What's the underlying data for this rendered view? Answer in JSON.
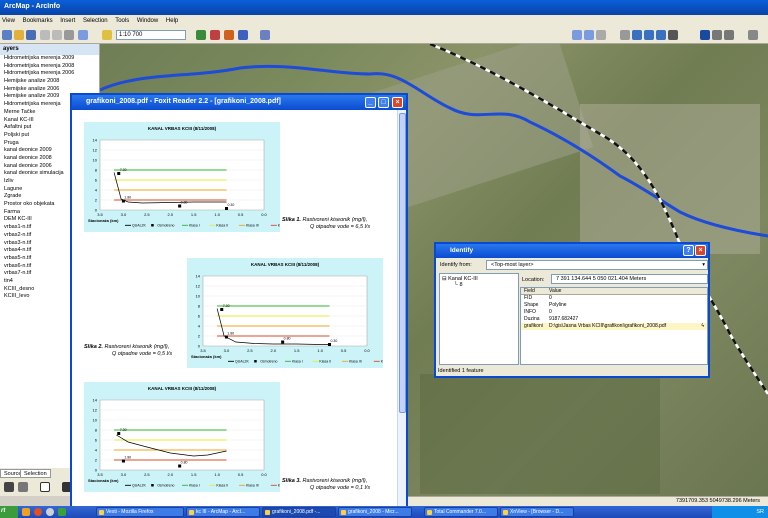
{
  "arcmap": {
    "title": "ArcMap - ArcInfo",
    "menu": [
      "View",
      "Bookmarks",
      "Insert",
      "Selection",
      "Tools",
      "Window",
      "Help"
    ],
    "scale": "1:10 700"
  },
  "toc": {
    "header": "ayers",
    "layers": [
      "Hidrometrijska merenja 2009",
      "Hidrometrijska merenja 2008",
      "Hidrometrijska merenja 2006",
      "Hemijske analize 2008",
      "Hemijske analize 2006",
      "Hemijske analize 2009",
      "Hidrometrijska merenja",
      "Merne Tačke",
      "Kanal KC-III",
      "Asfaltni put",
      "Poljski put",
      "Pruga",
      "kanal deonice 2009",
      "kanal deonice 2008",
      "kanal deonice 2006",
      "kanal deonice simulacija",
      "Izliv",
      "Lagune",
      "Zgrade",
      "Prostor oko objekata",
      "Farma",
      "DEM KC-III",
      "vrbas1-n.tif",
      "vrbas2-n.tif",
      "vrbas3-n.tif",
      "vrbas4-n.tif",
      "vrbas5-n.tif",
      "vrbas6-n.tif",
      "vrbas7-n.tif",
      "tin4",
      "KCIII_desno",
      "KCIII_levo"
    ],
    "tabs": [
      "Source",
      "Selection"
    ]
  },
  "foxit": {
    "title": "grafikoni_2008.pdf - Foxit Reader 2.2 - [grafikoni_2008.pdf]",
    "captions": [
      {
        "label": "Slika 1.",
        "text": "Rastvoreni kiseonik (mg/l),",
        "sub": "Q otpadne vode = 6,5 l/s"
      },
      {
        "label": "Slika 2.",
        "text": "Rastvoreni kiseonik (mg/l),",
        "sub": "Q otpadne vode = 0,5 l/s"
      },
      {
        "label": "Slika 3.",
        "text": "Rastvoreni kiseonik (mg/l),",
        "sub": "Q otpadne vode = 0,1 l/s"
      }
    ]
  },
  "identify": {
    "title": "Identify",
    "from_label": "Identify from:",
    "from_value": "<Top-most layer>",
    "tree_layer": "Kanal KC-III",
    "tree_child": "8",
    "location_label": "Location:",
    "location_value": "7 391 134.644  5 050 021.404 Meters",
    "columns": [
      "Field",
      "Value"
    ],
    "rows": [
      {
        "field": "FID",
        "value": "0"
      },
      {
        "field": "Shape",
        "value": "Polyline"
      },
      {
        "field": "INFO",
        "value": "0"
      },
      {
        "field": "Duzina",
        "value": "9187.682427"
      },
      {
        "field": "grafikoni",
        "value": "D:\\gis\\Jasna Vrbas KCIII\\grafikoni\\grafikoni_2008.pdf"
      }
    ],
    "status": "Identified 1 feature"
  },
  "statusbar": {
    "coords": "7391709.353  5049738.296 Meters"
  },
  "taskbar": {
    "start": "rt",
    "tasks": [
      "Vesti - Mozilla Firefox",
      "kc III - ArcMap - ArcI...",
      "grafikoni_2008.pdf -...",
      "grafikoni_2008 - Micr...",
      "Total Commander 7.0...",
      "XnView - [Browser - D..."
    ],
    "tray": "SR"
  },
  "charts": [
    {
      "title": "KANAL VRBAS KCIII (8/11/2008)",
      "ylim": [
        0,
        14
      ],
      "yticks": [
        0,
        2,
        4,
        6,
        8,
        10,
        12,
        14
      ],
      "xticks": [
        "3.5",
        "3.0",
        "2.5",
        "2.0",
        "1.5",
        "1.0",
        "0.5",
        "0.0"
      ],
      "xlabel": "Stacionaža (km)",
      "legend": [
        "QUAL2K",
        "Osmotreno",
        "Klasa I",
        "Klasa II",
        "Klasa III",
        "Klasa IV"
      ],
      "point_labels": [
        "7.30",
        "1.80",
        "0.80",
        "0.30"
      ],
      "points": [
        [
          3.1,
          7.3
        ],
        [
          3.0,
          1.8
        ],
        [
          1.8,
          0.8
        ],
        [
          0.8,
          0.3
        ]
      ],
      "curve": [
        [
          3.2,
          7.5
        ],
        [
          3.05,
          2.2
        ],
        [
          2.9,
          1.6
        ],
        [
          2.6,
          1.4
        ],
        [
          2.0,
          1.5
        ],
        [
          1.5,
          1.6
        ],
        [
          1.0,
          1.6
        ],
        [
          0.8,
          1.6
        ]
      ],
      "classes": [
        8,
        6,
        4,
        2
      ],
      "class_colors": [
        "#2cb52c",
        "#e8e83a",
        "#f0a020",
        "#d84a2a"
      ]
    },
    {
      "title": "KANAL VRBAS KCIII (8/11/2008)",
      "ylim": [
        0,
        14
      ],
      "yticks": [
        0,
        2,
        4,
        6,
        8,
        10,
        12,
        14
      ],
      "xticks": [
        "3.5",
        "3.0",
        "2.5",
        "2.0",
        "1.5",
        "1.0",
        "0.5",
        "0.0"
      ],
      "xlabel": "Stacionaža (km)",
      "legend": [
        "QUAL2K",
        "Osmotreno",
        "Klasa I",
        "Klasa II",
        "Klasa III",
        "Klasa IV"
      ],
      "point_labels": [
        "7.30",
        "1.80",
        "0.80",
        "0.30"
      ],
      "points": [
        [
          3.1,
          7.3
        ],
        [
          3.0,
          1.8
        ],
        [
          1.8,
          0.8
        ],
        [
          0.8,
          0.3
        ]
      ],
      "curve": [
        [
          3.2,
          7.5
        ],
        [
          3.05,
          2.0
        ],
        [
          2.8,
          0.8
        ],
        [
          2.4,
          0.5
        ],
        [
          2.0,
          0.4
        ],
        [
          1.5,
          0.4
        ],
        [
          1.0,
          0.3
        ],
        [
          0.8,
          0.3
        ]
      ],
      "classes": [
        8,
        6,
        4,
        2
      ],
      "class_colors": [
        "#2cb52c",
        "#e8e83a",
        "#f0a020",
        "#d84a2a"
      ]
    },
    {
      "title": "KANAL VRBAS KCIII (8/11/2008)",
      "ylim": [
        0,
        14
      ],
      "yticks": [
        0,
        2,
        4,
        6,
        8,
        10,
        12,
        14
      ],
      "xticks": [
        "3.5",
        "3.0",
        "2.5",
        "2.0",
        "1.5",
        "1.0",
        "0.5",
        "0.0"
      ],
      "xlabel": "Stacionaža (km)",
      "legend": [
        "QUAL2K",
        "Osmotreno",
        "Klasa I",
        "Klasa II",
        "Klasa III",
        "Klasa IV"
      ],
      "point_labels": [
        "7.30",
        "1.80",
        "0.80"
      ],
      "points": [
        [
          3.1,
          7.3
        ],
        [
          3.0,
          1.8
        ],
        [
          1.8,
          0.8
        ]
      ],
      "curve": [
        [
          3.15,
          7.0
        ],
        [
          2.9,
          5.6
        ],
        [
          2.5,
          4.6
        ],
        [
          2.0,
          3.4
        ],
        [
          1.5,
          2.8
        ],
        [
          1.2,
          3.0
        ],
        [
          0.9,
          3.6
        ],
        [
          0.8,
          3.8
        ]
      ],
      "classes": [
        8,
        6,
        4,
        2
      ],
      "class_colors": [
        "#2cb52c",
        "#e8e83a",
        "#f0a020",
        "#d84a2a"
      ]
    }
  ]
}
